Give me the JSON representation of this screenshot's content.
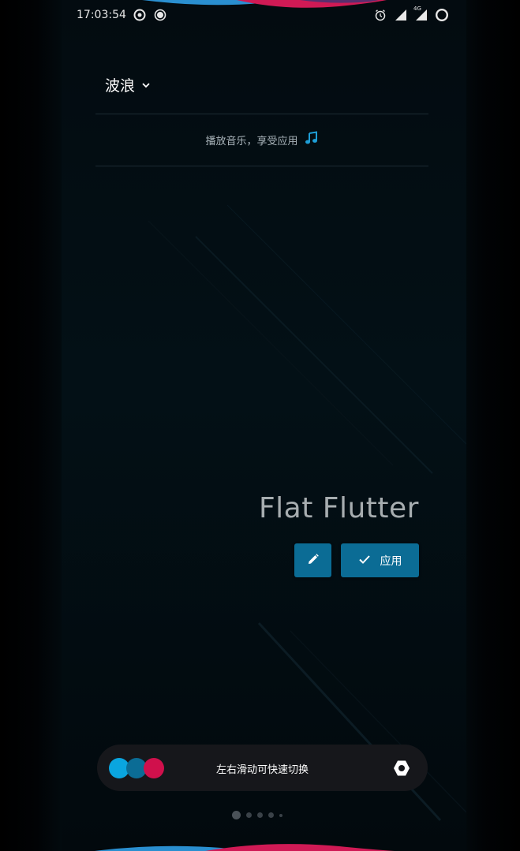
{
  "status_bar": {
    "time": "17:03:54",
    "network_label": "4G"
  },
  "header": {
    "title": "波浪"
  },
  "hint": {
    "text": "播放音乐，享受应用"
  },
  "theme": {
    "name": "Flat Flutter",
    "apply_label": "应用"
  },
  "bottom_bar": {
    "text": "左右滑动可快速切换",
    "swatch_colors": [
      "#0aa5df",
      "#0b6c95",
      "#d0104c"
    ]
  },
  "pager": {
    "page_count": 5,
    "current_page": 1
  },
  "colors": {
    "accent": "#0b6c95",
    "music_note": "#1e9ed6",
    "wave_blue": "#2a8fd0",
    "wave_pink": "#d01a55"
  }
}
